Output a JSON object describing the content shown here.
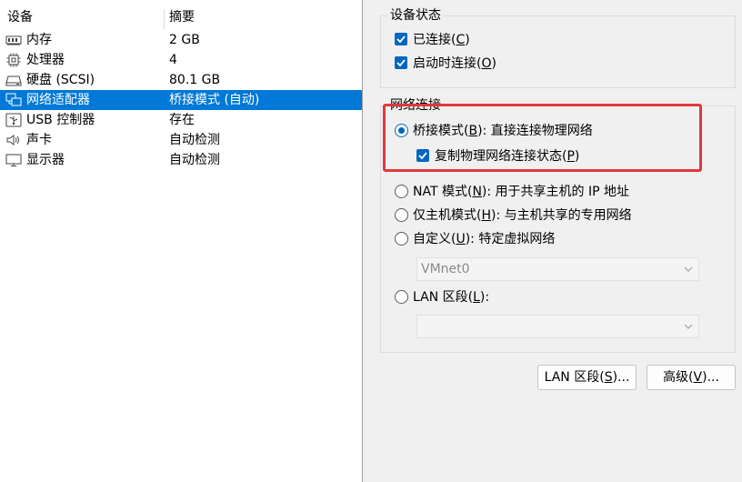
{
  "device_list": {
    "columns": [
      "设备",
      "摘要"
    ],
    "rows": [
      {
        "icon": "memory-icon",
        "name": "内存",
        "summary": "2 GB",
        "selected": false
      },
      {
        "icon": "processor-icon",
        "name": "处理器",
        "summary": "4",
        "selected": false
      },
      {
        "icon": "hard-disk-icon",
        "name": "硬盘 (SCSI)",
        "summary": "80.1 GB",
        "selected": false
      },
      {
        "icon": "network-adapter-icon",
        "name": "网络适配器",
        "summary": "桥接模式 (自动)",
        "selected": true
      },
      {
        "icon": "usb-icon",
        "name": "USB 控制器",
        "summary": "存在",
        "selected": false
      },
      {
        "icon": "sound-card-icon",
        "name": "声卡",
        "summary": "自动检测",
        "selected": false
      },
      {
        "icon": "display-icon",
        "name": "显示器",
        "summary": "自动检测",
        "selected": false
      }
    ]
  },
  "device_status": {
    "title": "设备状态",
    "connected": {
      "label_pre": "已连接(",
      "key": "C",
      "label_post": ")",
      "checked": true
    },
    "connect_at_power_on": {
      "label_pre": "启动时连接(",
      "key": "O",
      "label_post": ")",
      "checked": true
    }
  },
  "network_connection": {
    "title": "网络连接",
    "bridged": {
      "label_pre": "桥接模式(",
      "key": "B",
      "label_post": "): 直接连接物理网络",
      "selected": true
    },
    "replicate": {
      "label_pre": "复制物理网络连接状态(",
      "key": "P",
      "label_post": ")",
      "checked": true
    },
    "nat": {
      "label_pre": "NAT 模式(",
      "key": "N",
      "label_post": "): 用于共享主机的 IP 地址",
      "selected": false
    },
    "host_only": {
      "label_pre": "仅主机模式(",
      "key": "H",
      "label_post": "): 与主机共享的专用网络",
      "selected": false
    },
    "custom": {
      "label_pre": "自定义(",
      "key": "U",
      "label_post": "): 特定虚拟网络",
      "selected": false
    },
    "custom_select_value": "VMnet0",
    "lan_segment": {
      "label_pre": "LAN 区段(",
      "key": "L",
      "label_post": "):",
      "selected": false
    },
    "lan_select_value": ""
  },
  "buttons": {
    "lan_segments": {
      "label_pre": "LAN 区段(",
      "key": "S",
      "label_post": ")..."
    },
    "advanced": {
      "label_pre": "高级(",
      "key": "V",
      "label_post": ")..."
    }
  },
  "colors": {
    "selection": "#0078d7",
    "accent": "#0067c0",
    "highlight": "#e0383b"
  }
}
